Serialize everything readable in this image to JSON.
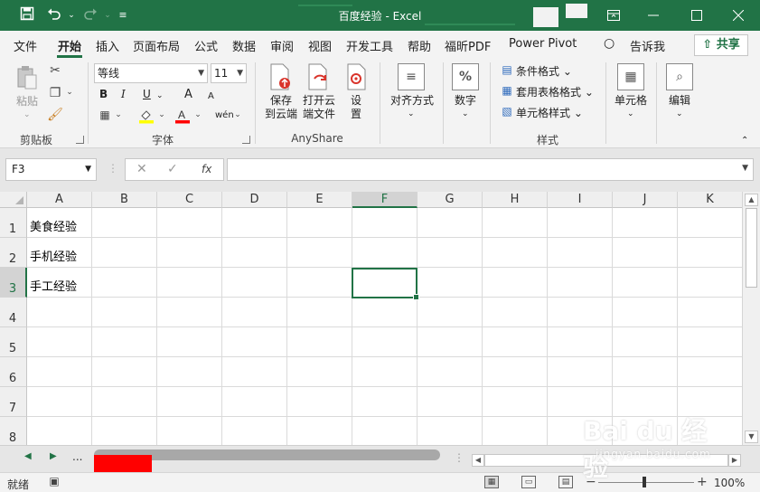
{
  "window": {
    "title": "百度经验  -  Excel",
    "accent": "#217346"
  },
  "qat": {
    "save_icon": "save-icon",
    "undo_icon": "undo-icon",
    "redo_icon": "redo-icon",
    "customize_icon": "customize-icon"
  },
  "tabs": [
    "文件",
    "开始",
    "插入",
    "页面布局",
    "公式",
    "数据",
    "审阅",
    "视图",
    "开发工具",
    "帮助",
    "福昕PDF",
    "Power Pivot",
    "告诉我"
  ],
  "active_tab": "开始",
  "share_label": "共享",
  "ribbon": {
    "clipboard": {
      "paste": "粘贴",
      "group": "剪贴板"
    },
    "font": {
      "font_name": "等线",
      "font_size": "11",
      "bold": "B",
      "italic": "I",
      "underline": "U",
      "grow": "A",
      "shrink": "A",
      "wen": "wén",
      "group": "字体"
    },
    "anyshare": {
      "save_to_cloud_l1": "保存",
      "save_to_cloud_l2": "到云端",
      "open_cloud_l1": "打开云",
      "open_cloud_l2": "端文件",
      "settings_l1": "设",
      "settings_l2": "置",
      "group": "AnyShare"
    },
    "alignment": {
      "label": "对齐方式"
    },
    "number": {
      "label": "数字"
    },
    "styles": {
      "conditional": "条件格式",
      "table_format": "套用表格格式",
      "cell_styles": "单元格样式",
      "group": "样式"
    },
    "cells": {
      "label": "单元格"
    },
    "editing": {
      "label": "编辑"
    }
  },
  "formula_bar": {
    "name_box": "F3",
    "fx": "fx",
    "value": ""
  },
  "grid": {
    "columns": [
      "A",
      "B",
      "C",
      "D",
      "E",
      "F",
      "G",
      "H",
      "I",
      "J",
      "K"
    ],
    "rows": [
      "1",
      "2",
      "3",
      "4",
      "5",
      "6",
      "7",
      "8"
    ],
    "selected_cell": "F3",
    "cells": {
      "A1": "美食经验",
      "A2": "手机经验",
      "A3": "手工经验"
    }
  },
  "sheet_bar": {
    "dots": "..."
  },
  "status_bar": {
    "ready": "就绪",
    "zoom": "100%"
  },
  "watermark": {
    "brand": "Bai du 经验",
    "url": "jingyan.baidu.com"
  }
}
